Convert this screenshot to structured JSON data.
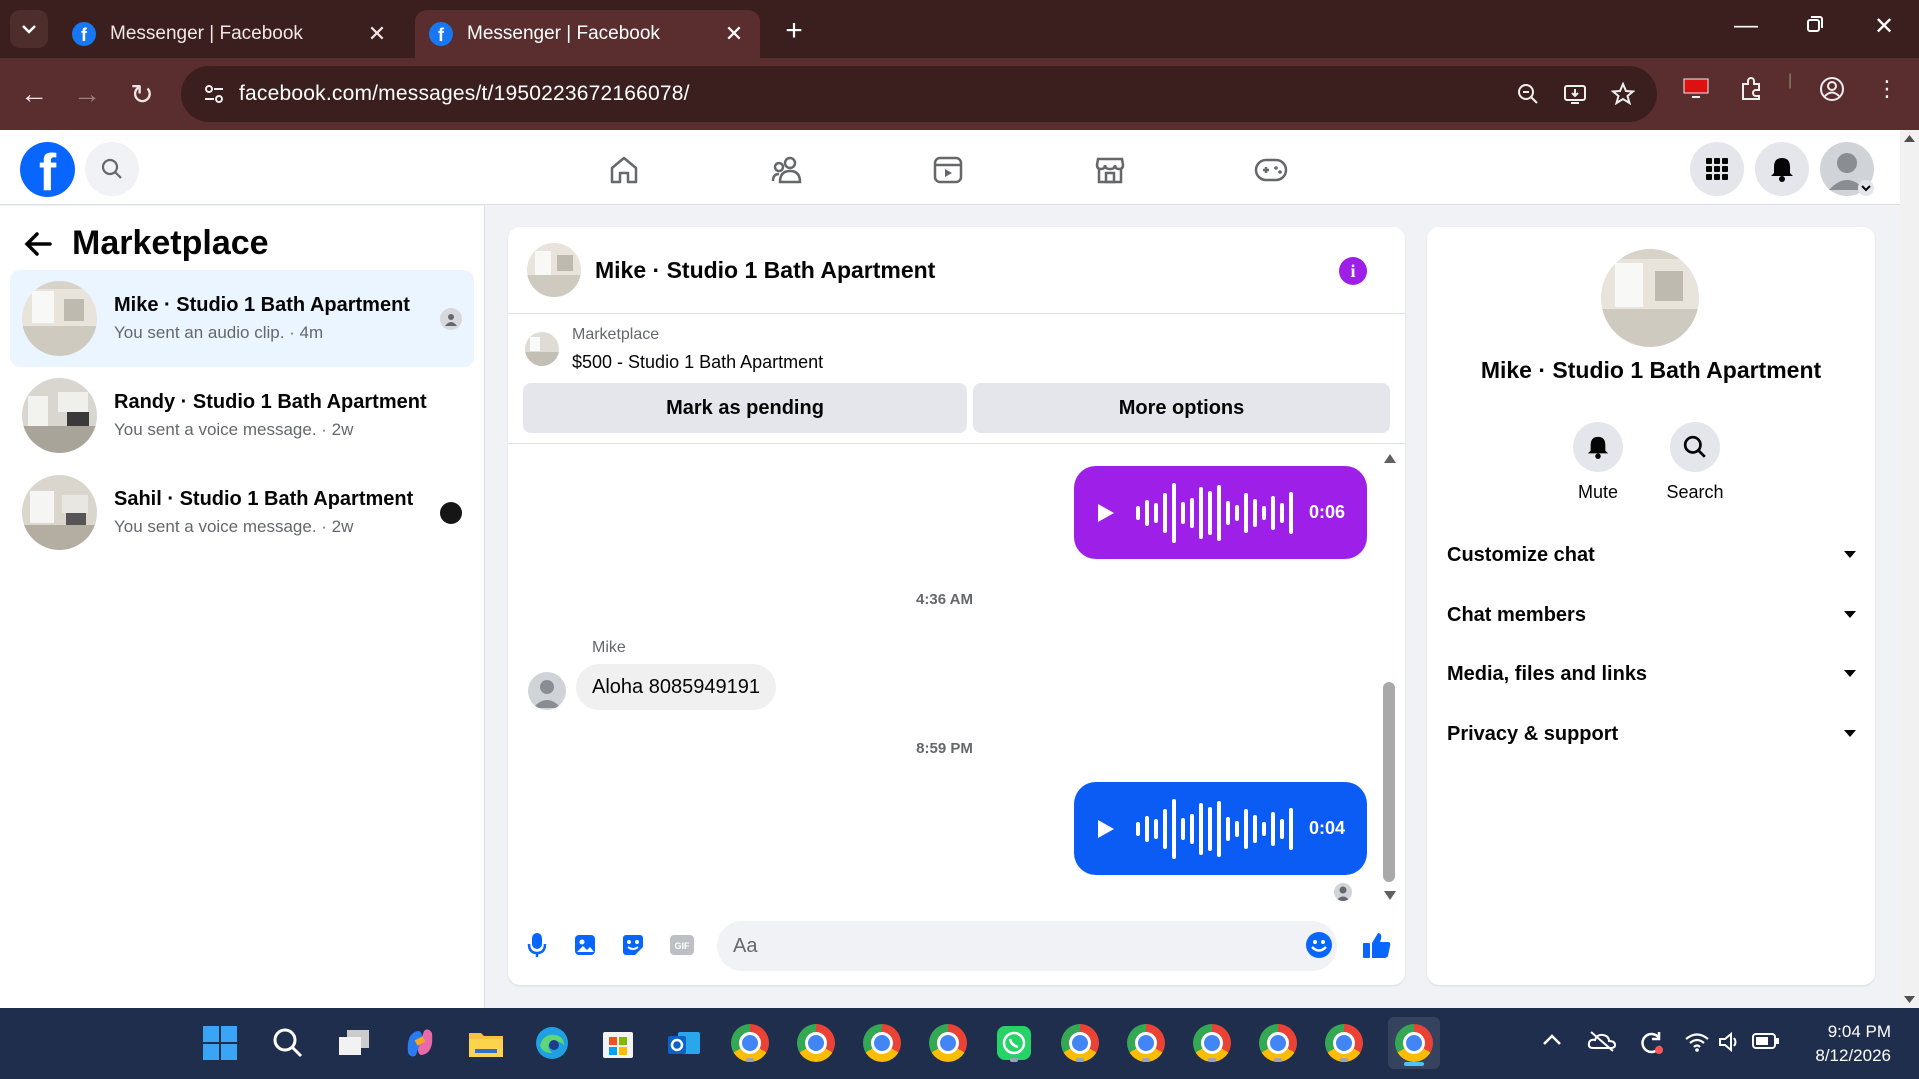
{
  "browser": {
    "tabs": [
      {
        "title": "Messenger | Facebook",
        "active": false
      },
      {
        "title": "Messenger | Facebook",
        "active": true
      }
    ],
    "url": "facebook.com/messages/t/1950223672166078/"
  },
  "sidebar": {
    "title": "Marketplace",
    "conversations": [
      {
        "name": "Mike · Studio 1 Bath Apartment",
        "preview": "You sent an audio clip. · 4m",
        "selected": true
      },
      {
        "name": "Randy · Studio 1 Bath Apartment",
        "preview": "You sent a voice message. · 2w",
        "selected": false
      },
      {
        "name": "Sahil · Studio 1 Bath Apartment",
        "preview": "You sent a voice message. · 2w",
        "selected": false
      }
    ]
  },
  "chat": {
    "title": "Mike · Studio 1 Bath Apartment",
    "listing": {
      "label": "Marketplace",
      "price_title": "$500 - Studio 1 Bath Apartment",
      "btn_pending": "Mark as pending",
      "btn_more": "More options"
    },
    "messages": {
      "audio1_duration": "0:06",
      "time1": "4:36 AM",
      "sender": "Mike",
      "text": "Aloha 8085949191",
      "time2": "8:59 PM",
      "audio2_duration": "0:04"
    },
    "composer_placeholder": "Aa"
  },
  "info_panel": {
    "name": "Mike · Studio 1 Bath Apartment",
    "actions": {
      "mute": "Mute",
      "search": "Search"
    },
    "sections": [
      "Customize chat",
      "Chat members",
      "Media, files and links",
      "Privacy & support"
    ]
  },
  "taskbar": {
    "time": "9:04 PM",
    "date": "8/12/2026"
  },
  "colors": {
    "fb_blue": "#0866ff",
    "audio_purple": "#9d1fe8",
    "audio_blue": "#0a5cf5",
    "selected_row": "#ebf5ff"
  },
  "icons": [
    "home-icon",
    "friends-icon",
    "video-icon",
    "marketplace-icon",
    "gaming-icon",
    "grid-menu-icon",
    "bell-icon",
    "mic-icon",
    "image-icon",
    "sticker-icon",
    "gif-icon",
    "emoji-icon",
    "like-icon",
    "info-icon"
  ]
}
